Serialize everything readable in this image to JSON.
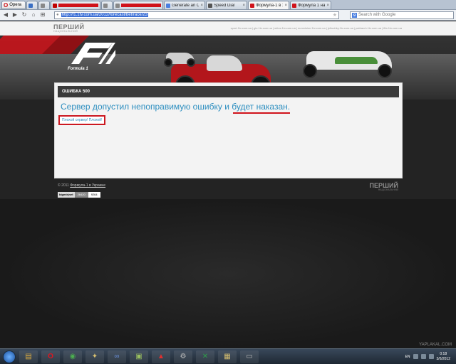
{
  "browser": {
    "menu_label": "Opera",
    "tabs": [
      {
        "label": "",
        "favicon_color": "#3a6fc4",
        "redacted": false,
        "active": false
      },
      {
        "label": "",
        "favicon_color": "#888888",
        "redacted": false,
        "active": false
      },
      {
        "label": "",
        "favicon_color": "#c00000",
        "redacted": true,
        "active": false
      },
      {
        "label": "",
        "favicon_color": "#888888",
        "redacted": false,
        "active": false
      },
      {
        "label": "",
        "favicon_color": "#888888",
        "redacted": true,
        "active": false
      },
      {
        "label": "Generate an Onli...",
        "favicon_color": "#4a7fe0",
        "redacted": false,
        "active": false
      },
      {
        "label": "Speed Dial",
        "favicon_color": "#555555",
        "redacted": false,
        "active": false
      },
      {
        "label": "Формула-1 в Ук...",
        "favicon_color": "#d0121a",
        "redacted": false,
        "active": true
      },
      {
        "label": "Формула 1 на F1...",
        "favicon_color": "#d0121a",
        "redacted": false,
        "active": false
      }
    ],
    "url": "http://f1.1tv.com.ua/2012/forecast/bet/race/23",
    "search_placeholder": "Search with Google"
  },
  "site": {
    "brand": "ПЕРШИЙ",
    "brand_sub": "НАЦІОНАЛЬНИЙ",
    "network_links": "sport.1tv.com.ua | gtc.1tv.com.ua | sirius.1tv.com.ua | eurovision.1tv.com.ua | jeltouhky.1tv.com.ua | patriarch.1tv.com.ua | fifa.1tv.com.ua",
    "f1_sub": "Formula 1"
  },
  "error": {
    "header": "ОШИБКА 500",
    "message_part1": "Сервер допустил непоправимую ошибку и ",
    "message_part2": "будет наказан",
    "message_part3": ".",
    "sub": "Плохой сервер! Плохой!"
  },
  "footer": {
    "copyright_prefix": "© 2011 ",
    "copyright_link": "Формула-1 в Украине",
    "brand": "ПЕРШИЙ",
    "brand_sub": "НАЦІОНАЛЬНИЙ",
    "counter_name": "bigmir)net",
    "counter_a": "26420",
    "counter_b": "9264"
  },
  "taskbar": {
    "lang": "EN",
    "time": "0:18",
    "date": "3/6/2012",
    "watermark": "YAPLAKAL.COM"
  }
}
